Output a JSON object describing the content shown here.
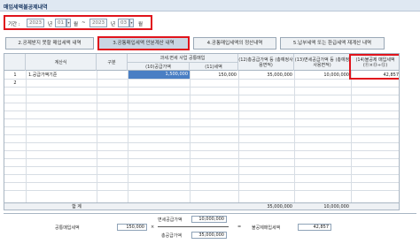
{
  "window": {
    "title": "매입세액불공제내역"
  },
  "period": {
    "label": "기간 :",
    "from_year": "2023",
    "year_unit": "년",
    "from_month": "01",
    "month_unit": "월",
    "separator": "~",
    "to_year": "2023",
    "to_month": "03"
  },
  "tabs": [
    {
      "label": "2.공제받지 못할 매입세액 내역"
    },
    {
      "label": "3.공통매입세액 안분계산 내역"
    },
    {
      "label": "4.공통매입세액의 정산내역"
    },
    {
      "label": "5.납부세액 또는 환급세액 재계산 내역"
    }
  ],
  "grid": {
    "headers": {
      "calc": "계산식",
      "div": "구분",
      "group": "과세.면세 사업 공통매입",
      "supply": "(10)공급가액",
      "tax": "(11)세액",
      "c12": "(12)총공급가액 등 (총예정사용면적)",
      "c13": "(13)면세공급가액 등 (총예정사용면적)",
      "c14_line1": "(14)불공제 매입세액",
      "c14_line2": "(⑪×⑬÷⑫)"
    },
    "rows": [
      {
        "no": "1",
        "calc": "1.공급가액기준",
        "div": "",
        "supply": "1,500,000",
        "tax": "150,000",
        "c12": "35,000,000",
        "c13": "10,000,000",
        "c14": "42,857"
      },
      {
        "no": "2",
        "calc": "",
        "div": "",
        "supply": "",
        "tax": "",
        "c12": "",
        "c13": "",
        "c14": ""
      }
    ],
    "total": {
      "label": "합 계",
      "c12": "35,000,000",
      "c13": "10,000,000"
    }
  },
  "formula": {
    "label_common": "공통매입세액",
    "common_value": "150,000",
    "times1": "×",
    "label_exempt": "면세공급가액",
    "exempt_value": "10,000,000",
    "label_total": "총공급가액",
    "total_value": "35,000,000",
    "equals": "=",
    "label_result": "불공제매입세액",
    "result_value": "42,857"
  }
}
